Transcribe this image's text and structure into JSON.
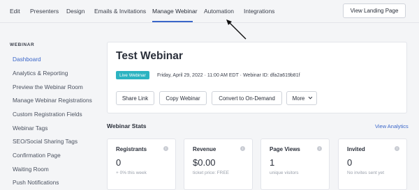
{
  "nav": {
    "tabs": [
      {
        "label": "Edit"
      },
      {
        "label": "Presenters"
      },
      {
        "label": "Design"
      },
      {
        "label": "Emails & Invitations"
      },
      {
        "label": "Manage Webinar"
      },
      {
        "label": "Automation"
      },
      {
        "label": "Integrations"
      }
    ],
    "active_tab": "Manage Webinar",
    "landing_button": "View Landing Page"
  },
  "sidebar": {
    "section_title": "WEBINAR",
    "items": [
      {
        "label": "Dashboard"
      },
      {
        "label": "Analytics & Reporting"
      },
      {
        "label": "Preview the Webinar Room"
      },
      {
        "label": "Manage Webinar Registrations"
      },
      {
        "label": "Custom Registration Fields"
      },
      {
        "label": "Webinar Tags"
      },
      {
        "label": "SEO/Social Sharing Tags"
      },
      {
        "label": "Confirmation Page"
      },
      {
        "label": "Waiting Room"
      },
      {
        "label": "Push Notifications"
      }
    ],
    "active_item": "Dashboard"
  },
  "webinar": {
    "title": "Test Webinar",
    "badge": "Live Webinar",
    "meta": "Friday, April 29, 2022 · 11:00 AM EDT · Webinar ID: dfa2a619b81f",
    "actions": {
      "share": "Share Link",
      "copy": "Copy Webinar",
      "convert": "Convert to On-Demand",
      "more": "More"
    }
  },
  "stats": {
    "title": "Webinar Stats",
    "view_analytics": "View Analytics",
    "cards": [
      {
        "label": "Registrants",
        "value": "0",
        "sub": "+ 0% this week"
      },
      {
        "label": "Revenue",
        "value": "$0.00",
        "sub": "ticket price: FREE"
      },
      {
        "label": "Page Views",
        "value": "1",
        "sub": "unique visitors"
      },
      {
        "label": "Invited",
        "value": "0",
        "sub": "No invites sent yet"
      }
    ]
  },
  "colors": {
    "accent": "#3a66c9",
    "live_badge": "#2cb3c1",
    "background": "#f4f5f7"
  }
}
